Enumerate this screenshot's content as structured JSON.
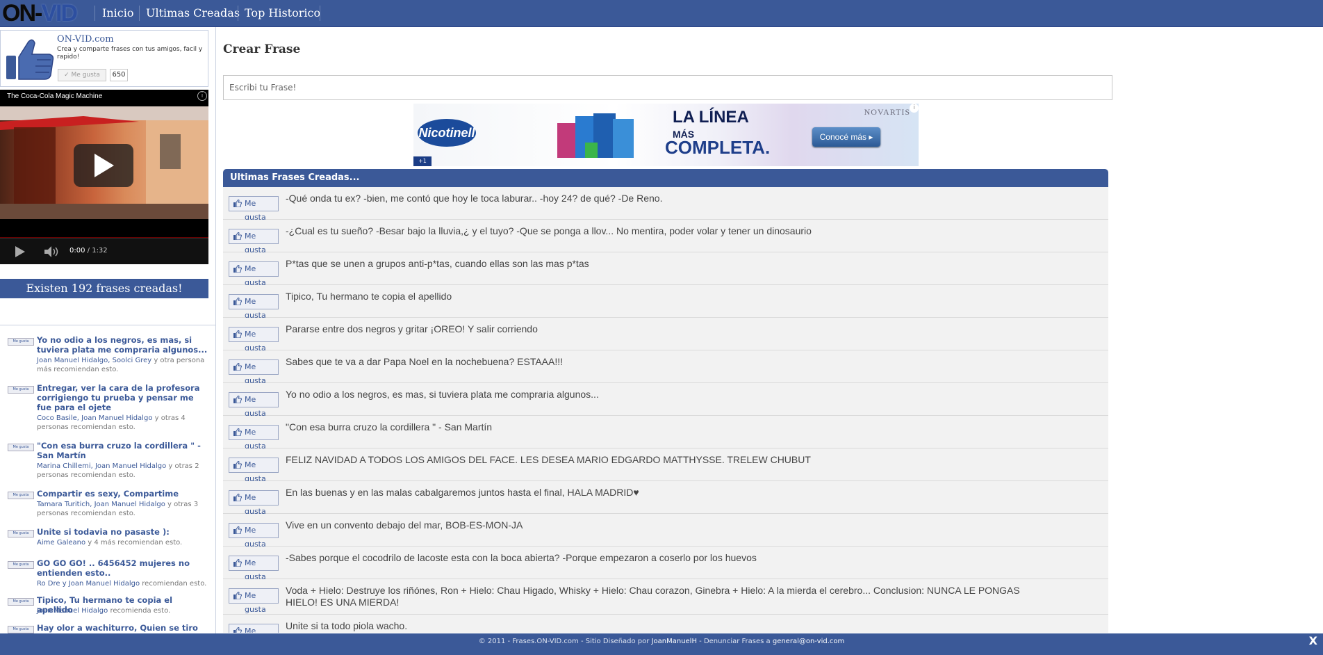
{
  "nav": {
    "logo": {
      "part1": "ON",
      "part2": "-",
      "part3": "VID"
    },
    "links": [
      "Inicio",
      "Ultimas Creadas",
      "Top Historico"
    ]
  },
  "fb_box": {
    "title": "ON-VID.com",
    "description": "Crea y comparte frases con tus amigos, facil y rapido!",
    "like_label": "Me gusta",
    "like_count": "650"
  },
  "video": {
    "title": "The Coca-Cola Magic Machine",
    "time_current": "0:00",
    "time_total": "/ 1:32",
    "info": "i"
  },
  "count_banner": "Existen 192 frases creadas!",
  "recommendations": [
    {
      "title": "Yo no odio a los negros, es mas, si tuviera plata me compraria algunos...",
      "names": "Joan Manuel Hidalgo, Soolci Grey",
      "rest": " y otra persona más recomiendan esto."
    },
    {
      "title": "Entregar, ver la cara de la profesora corrigiengo tu prueba y pensar me fue para el ojete",
      "names": "Coco Basile, Joan Manuel Hidalgo",
      "rest": " y otras 4 personas recomiendan esto."
    },
    {
      "title": "\"Con esa burra cruzo la cordillera \" - San Martín",
      "names": "Marina Chillemi, Joan Manuel Hidalgo",
      "rest": " y otras 2 personas recomiendan esto."
    },
    {
      "title": "Compartir es sexy, Compartime",
      "names": "Tamara Turitich, Joan Manuel Hidalgo",
      "rest": " y otras 3 personas recomiendan esto."
    },
    {
      "title": "Unite si todavia no pasaste ):",
      "names": "Aime Galeano",
      "rest": " y 4 más recomiendan esto."
    },
    {
      "title": "GO GO GO! .. 6456452 mujeres no entienden esto..",
      "names": "Ro Dre y Joan Manuel Hidalgo",
      "rest": " recomiendan esto."
    },
    {
      "title": "Tipico, Tu hermano te copia el apellido",
      "names": "Joan Manuel Hidalgo",
      "rest": " recomienda esto."
    },
    {
      "title": "Hay olor a wachiturro, Quien se tiro un paso",
      "names": "",
      "rest": ""
    }
  ],
  "rec_like_label": "Me gusta",
  "main": {
    "title": "Crear Frase",
    "input_placeholder": "Escribi tu Frase!",
    "list_header": "Ultimas Frases Creadas...",
    "like_label": "Me gusta",
    "phrases": [
      "-Qué onda tu ex? -bien, me contó que hoy le toca laburar.. -hoy 24? de qué? -De Reno.",
      "-¿Cual es tu sueño? -Besar bajo la lluvia,¿ y el tuyo? -Que se ponga a llov... No mentira, poder volar y tener un dinosaurio",
      "P*tas que se unen a grupos anti-p*tas, cuando ellas son las mas p*tas",
      "Tipico, Tu hermano te copia el apellido",
      "Pararse entre dos negros y gritar ¡OREO! Y salir corriendo",
      "Sabes que te va a dar Papa Noel en la nochebuena? ESTAAA!!!",
      "Yo no odio a los negros, es mas, si tuviera plata me compraria algunos...",
      "\"Con esa burra cruzo la cordillera \" - San Martín",
      "FELIZ NAVIDAD A TODOS LOS AMIGOS DEL FACE. LES DESEA MARIO EDGARDO MATTHYSSE. TRELEW CHUBUT",
      "En las buenas y en las malas cabalgaremos juntos hasta el final, HALA MADRID♥",
      "Vive en un convento debajo del mar, BOB-ES-MON-JA",
      "-Sabes porque el cocodrilo de lacoste esta con la boca abierta? -Porque empezaron a coserlo por los huevos",
      "Voda + Hielo: Destruye los riñónes, Ron + Hielo: Chau Higado, Whisky + Hielo: Chau corazon, Ginebra + Hielo: A la mierda el cerebro... Conclusion: NUNCA LE PONGAS HIELO! ES UNA MIERDA!",
      "Unite si ta todo piola wacho."
    ]
  },
  "ad": {
    "logo": "Nicotinell",
    "line1": "LA LÍNEA",
    "line2": "MÁS",
    "line3": "COMPLETA.",
    "brand": "NOVARTIS",
    "button": "Conocé más",
    "badge": "+1",
    "info": "i"
  },
  "footer": {
    "prefix": "© 2011 - Frases.ON-VID.com - Sitio Diseñado por ",
    "author": "JoanManuelH",
    "middle": " - Denunciar Frases a ",
    "email": "general@on-vid.com",
    "close": "X"
  },
  "colors": {
    "brand": "#3b5998",
    "row_bg": "#f2f2f2"
  }
}
